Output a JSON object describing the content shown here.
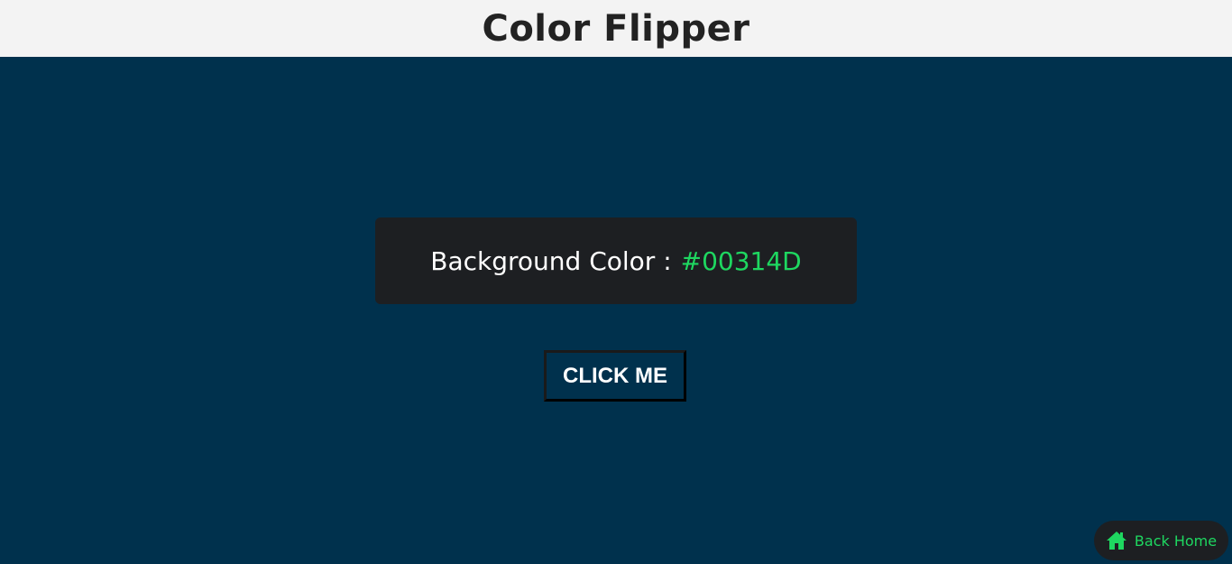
{
  "header": {
    "title": "Color Flipper"
  },
  "color_display": {
    "label": "Background Color :",
    "value": "#00314D"
  },
  "flip_button": {
    "label": "CLICK ME"
  },
  "home_link": {
    "label": "Back Home",
    "icon": "home-icon"
  },
  "colors": {
    "background": "#00314D",
    "header_bg": "#F3F3F3",
    "card_bg": "#1D1F22",
    "accent": "#1ED760"
  }
}
